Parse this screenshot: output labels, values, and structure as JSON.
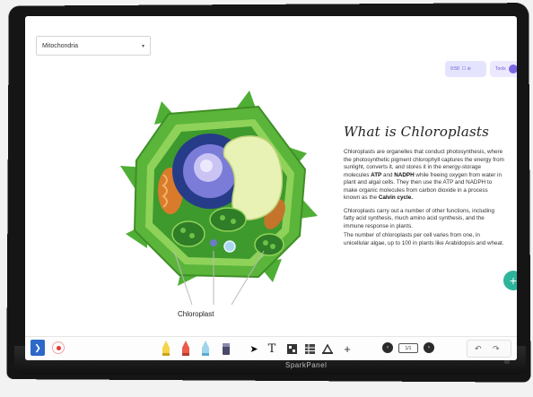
{
  "screen": {
    "dropdown": {
      "value": "Mitochondria",
      "caret": "▾"
    },
    "top_right_pills": [
      {
        "label": "9:58",
        "sub": "☐ ⊘"
      },
      {
        "label": "Tools"
      }
    ]
  },
  "illustration": {
    "callout_label": "Chloroplast",
    "colors": {
      "wall_outer": "#5bb53a",
      "wall_inner": "#8fd25a",
      "cytoplasm": "#3e9a2d",
      "nucleus": "#7b7bd8",
      "vacuole": "#e8f2b5",
      "chloroplast": "#2f7d26",
      "mitochondria": "#d97b2b"
    }
  },
  "article": {
    "title": "What is Chloroplasts",
    "para1_before_atp": "Chloroplasts are organelles that conduct photosynthesis, where the photosynthetic pigment chlorophyll captures the energy from sunlight, converts it, and stores it in the energy-storage molecules ",
    "atp": "ATP",
    "and": " and ",
    "nadph": "NADPH",
    "para1_after": " while freeing oxygen from water in plant and algal cells. They then use the ATP and NADPH to make organic molecules from carbon dioxide in a process known as the ",
    "calvin": "Calvin cycle.",
    "para2": "Chloroplasts carry out a number of other functions, including fatty acid synthesis, much amino acid synthesis, and the immune response in plants.",
    "para3": "The number of chloroplasts per cell varies from one, in unicellular algae, up to 100 in plants like Arabidopsis and wheat."
  },
  "fab": {
    "icon": "+"
  },
  "collapse": {
    "icon": "^"
  },
  "toolbar": {
    "menu_icon": "❯",
    "page_indicator": "1/1",
    "prev_icon": "‹",
    "next_icon": "›",
    "undo_icon": "↶",
    "redo_icon": "↷",
    "tools": [
      "pen-yellow-icon",
      "pen-red-icon",
      "pen-blue-icon",
      "eraser-icon",
      "pointer-icon",
      "text-icon",
      "shapes-icon",
      "table-icon",
      "ruler-icon",
      "move-icon"
    ]
  },
  "bezel": {
    "brand": "SparkPanel"
  }
}
